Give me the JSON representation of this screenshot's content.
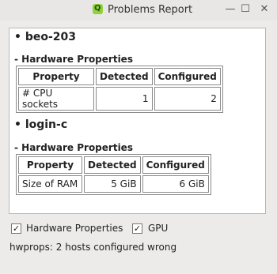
{
  "window": {
    "title": "Problems Report",
    "app_icon_letter": "Q",
    "minimize_glyph": "—",
    "maximize_glyph": "☐",
    "close_glyph": "✕"
  },
  "report": {
    "hosts": [
      {
        "name": "• beo-203",
        "section": "- Hardware Properties",
        "headers": [
          "Property",
          "Detected",
          "Configured"
        ],
        "rows": [
          [
            "# CPU sockets",
            "1",
            "2"
          ]
        ]
      },
      {
        "name": "• login-c",
        "section": "- Hardware Properties",
        "headers": [
          "Property",
          "Detected",
          "Configured"
        ],
        "rows": [
          [
            "Size of RAM",
            "5 GiB",
            "6 GiB"
          ]
        ]
      }
    ]
  },
  "filters": {
    "hardware": {
      "label": "Hardware Properties",
      "checked": true
    },
    "gpu": {
      "label": "GPU",
      "checked": true
    },
    "check_glyph": "✓"
  },
  "status": "hwprops: 2 hosts configured wrong"
}
